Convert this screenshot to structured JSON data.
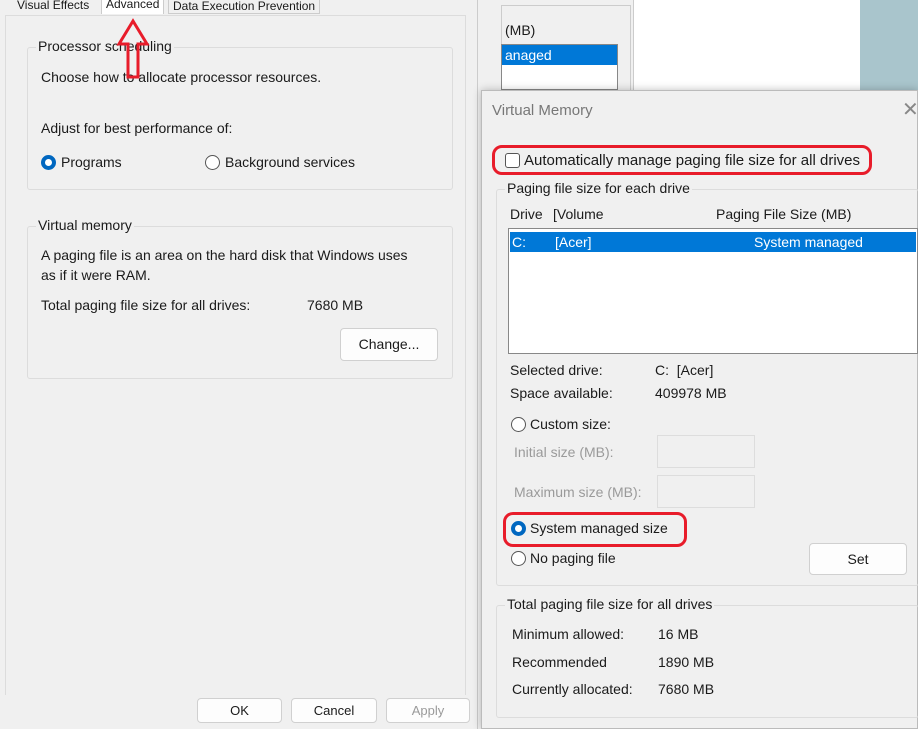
{
  "perf_dialog": {
    "tabs": [
      "Visual Effects",
      "Advanced",
      "Data Execution Prevention"
    ],
    "processor": {
      "title": "Processor scheduling",
      "desc": "Choose how to allocate processor resources.",
      "adjust": "Adjust for best performance of:",
      "opt_programs": "Programs",
      "opt_background": "Background services"
    },
    "vm": {
      "title": "Virtual memory",
      "desc1": "A paging file is an area on the hard disk that Windows uses",
      "desc2": "as if it were RAM.",
      "total_label": "Total paging file size for all drives:",
      "total_value": "7680 MB",
      "change": "Change..."
    },
    "ok": "OK",
    "cancel": "Cancel",
    "apply": "Apply"
  },
  "behind": {
    "header": "(MB)",
    "row": "anaged"
  },
  "vm_dialog": {
    "title": "Virtual Memory",
    "auto_manage": "Automatically manage paging file size for all drives",
    "each_drive": {
      "title": "Paging file size for each drive",
      "col_drive": "Drive",
      "col_volume": "[Volume",
      "col_size": "Paging File Size (MB)",
      "rows": [
        {
          "drive": "C:",
          "volume": "[Acer]",
          "size": "System managed"
        }
      ],
      "selected_label": "Selected drive:",
      "selected_value": "C:  [Acer]",
      "space_label": "Space available:",
      "space_value": "409978 MB",
      "custom": "Custom size:",
      "initial": "Initial size (MB):",
      "maximum": "Maximum size (MB):",
      "system": "System managed size",
      "none": "No paging file",
      "set": "Set"
    },
    "total": {
      "title": "Total paging file size for all drives",
      "min_label": "Minimum allowed:",
      "min_value": "16 MB",
      "rec_label": "Recommended",
      "rec_value": "1890 MB",
      "cur_label": "Currently allocated:",
      "cur_value": "7680 MB"
    }
  },
  "colors": {
    "accent": "#0078d7",
    "annotation": "#e81c2a"
  }
}
